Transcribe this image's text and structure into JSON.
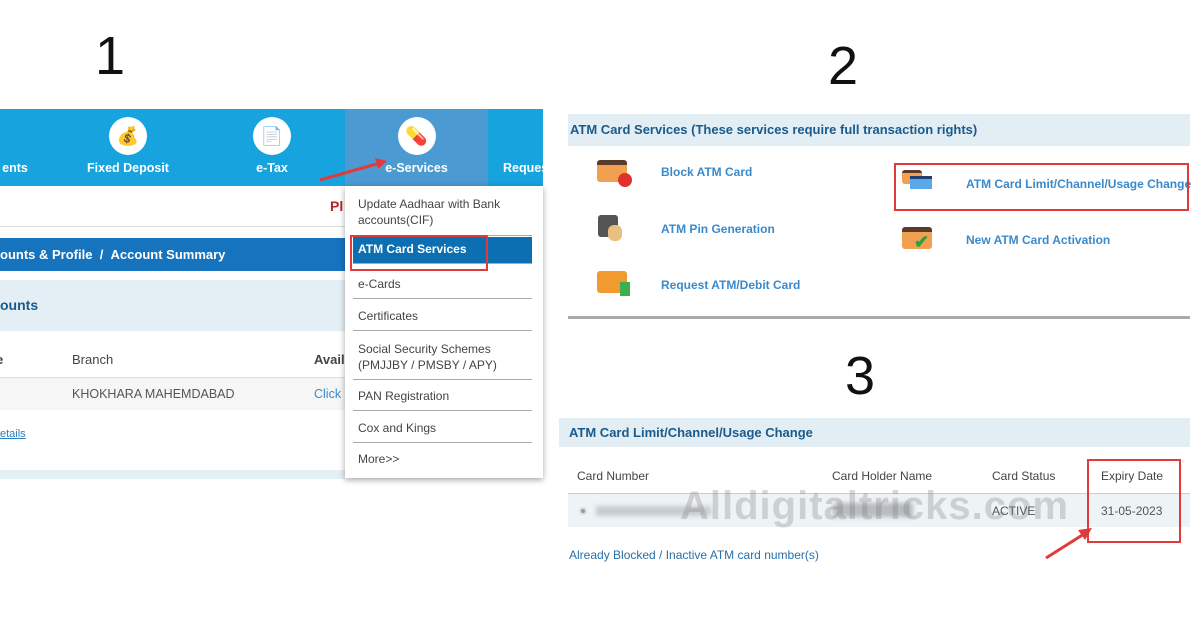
{
  "steps": [
    "1",
    "2",
    "3"
  ],
  "panel1": {
    "nav": [
      {
        "label": "ents",
        "icon": "deposit-icon"
      },
      {
        "label": "Fixed Deposit",
        "icon": "money-bag-icon"
      },
      {
        "label": "e-Tax",
        "icon": "tax-document-icon"
      },
      {
        "label": "e-Services",
        "icon": "e-services-icon"
      },
      {
        "label": "Reques",
        "icon": "request-icon"
      }
    ],
    "notice_fragment": "Pl",
    "breadcrumb": [
      "ounts & Profile",
      "/",
      "Account Summary"
    ],
    "section_title": "ounts",
    "table": {
      "headers": [
        "e",
        "Branch",
        "Avail"
      ],
      "row": [
        "KHOKHARA MAHEMDABAD",
        "Click"
      ]
    },
    "details_link": "etails",
    "menu": [
      "Update Aadhaar with Bank accounts(CIF)",
      "ATM Card Services",
      "e-Cards",
      "Certificates",
      "Social Security Schemes (PMJJBY / PMSBY / APY)",
      "PAN Registration",
      "Cox and Kings",
      "More>>"
    ]
  },
  "panel2": {
    "title": "ATM Card Services (These services require full transaction rights)",
    "services": [
      "Block ATM Card",
      "ATM Pin Generation",
      "Request ATM/Debit Card",
      "ATM Card Limit/Channel/Usage Change",
      "New ATM Card Activation"
    ]
  },
  "panel3": {
    "title": "ATM Card Limit/Channel/Usage Change",
    "headers": [
      "Card Number",
      "Card Holder Name",
      "Card Status",
      "Expiry Date"
    ],
    "row": {
      "status": "ACTIVE",
      "expiry": "31-05-2023"
    },
    "watermark": "Alldigitaltricks.com",
    "blocked_link": "Already Blocked / Inactive ATM card number(s)"
  },
  "colors": {
    "nav": "#17a3de",
    "highlight": "#0b6fb1",
    "annotation": "#e03a3a"
  }
}
